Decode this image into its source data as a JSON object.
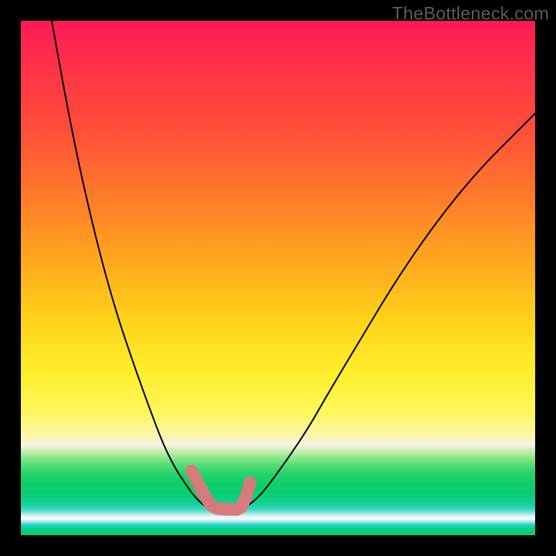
{
  "watermark": "TheBottleneck.com",
  "chart_data": {
    "type": "line",
    "title": "",
    "xlabel": "",
    "ylabel": "",
    "xlim": [
      0,
      100
    ],
    "ylim": [
      0,
      100
    ],
    "grid": false,
    "legend": false,
    "series": [
      {
        "name": "left-curve",
        "x": [
          6,
          10,
          14,
          18,
          22,
          26,
          28,
          30,
          32,
          33,
          34,
          35,
          36,
          37,
          38
        ],
        "y": [
          100,
          78,
          60,
          45,
          33,
          22,
          17,
          13,
          10,
          8.5,
          7.3,
          6.3,
          5.5,
          5.0,
          4.8
        ]
      },
      {
        "name": "right-curve",
        "x": [
          42,
          44,
          46,
          48,
          52,
          56,
          60,
          66,
          72,
          78,
          84,
          90,
          96,
          100
        ],
        "y": [
          4.8,
          5.6,
          7.2,
          9.5,
          15,
          21,
          28,
          38,
          48,
          57,
          65,
          72,
          78,
          82
        ]
      }
    ],
    "annotations": [
      {
        "name": "optimal-region-marker",
        "color": "#d77a7c",
        "points_x": [
          33.2,
          34.2,
          35.2,
          36.2,
          37.0,
          38.0,
          40.0,
          42.0,
          42.8,
          43.4,
          44.0,
          44.6
        ],
        "points_y": [
          12.5,
          10.5,
          8.7,
          7.0,
          5.8,
          5.2,
          5.0,
          5.0,
          5.4,
          6.6,
          8.2,
          10.2
        ]
      }
    ]
  }
}
